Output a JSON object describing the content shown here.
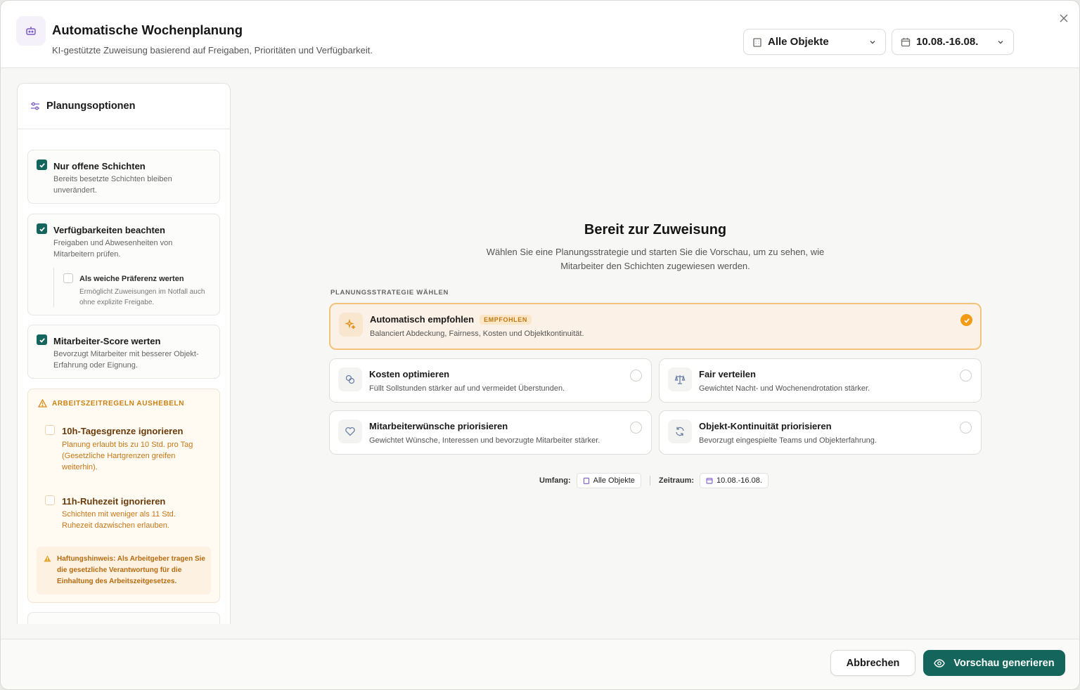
{
  "header": {
    "title": "Automatische Wochenplanung",
    "subtitle": "KI-gestützte Zuweisung basierend auf Freigaben, Prioritäten und Verfügbarkeit.",
    "objects_select": "Alle Objekte",
    "date_select": "10.08.-16.08."
  },
  "sidebar": {
    "title": "Planungsoptionen",
    "options": [
      {
        "title": "Nur offene Schichten",
        "desc_1": "Bereits besetzte Schichten bleiben",
        "desc_2": "unverändert.",
        "checked": true
      },
      {
        "title": "Verfügbarkeiten beachten",
        "desc_1": "Freigaben und Abwesenheiten von",
        "desc_2": "Mitarbeitern prüfen.",
        "checked": true,
        "sub": {
          "title": "Als weiche Präferenz werten",
          "desc_1": "Ermöglicht Zuweisungen im Notfall auch",
          "desc_2": "ohne explizite Freigabe.",
          "checked": false
        }
      },
      {
        "title": "Mitarbeiter-Score werten",
        "desc_1": "Bevorzugt Mitarbeiter mit besserer Objekt-",
        "desc_2": "Erfahrung oder Eignung.",
        "checked": true
      }
    ],
    "work_rules": {
      "header": "ARBEITSZEITREGELN AUSHEBELN",
      "items": [
        {
          "title": "10h-Tagesgrenze ignorieren",
          "desc_1": "Planung erlaubt bis zu 10 Std. pro Tag",
          "desc_2": "(Gesetzliche Hartgrenzen greifen",
          "desc_3": "weiterhin).",
          "checked": false
        },
        {
          "title": "11h-Ruhezeit ignorieren",
          "desc_1": "Schichten mit weniger als 11 Std.",
          "desc_2": "Ruhezeit dazwischen erlauben.",
          "checked": false
        }
      ],
      "liability": "Haftungshinweis: Als Arbeitgeber tragen Sie die gesetzliche Verantwortung für die Einhaltung des Arbeitszeitgesetzes."
    }
  },
  "main": {
    "title": "Bereit zur Zuweisung",
    "subtitle_1": "Wählen Sie eine Planungsstrategie und starten Sie die Vorschau, um zu sehen, wie",
    "subtitle_2": "Mitarbeiter den Schichten zugewiesen werden.",
    "strategy_label": "PLANUNGSSTRATEGIE WÄHLEN",
    "strategies": [
      {
        "title": "Automatisch empfohlen",
        "badge": "EMPFOHLEN",
        "desc": "Balanciert Abdeckung, Fairness, Kosten und Objektkontinuität.",
        "selected": true,
        "icon": "sparkles-icon"
      },
      {
        "title": "Kosten optimieren",
        "desc": "Füllt Sollstunden stärker auf und vermeidet Überstunden.",
        "selected": false,
        "icon": "coins-icon"
      },
      {
        "title": "Fair verteilen",
        "desc": "Gewichtet Nacht- und Wochenendrotation stärker.",
        "selected": false,
        "icon": "scale-icon"
      },
      {
        "title": "Mitarbeiterwünsche priorisieren",
        "desc": "Gewichtet Wünsche, Interessen und bevorzugte Mitarbeiter stärker.",
        "selected": false,
        "icon": "heart-icon"
      },
      {
        "title": "Objekt-Kontinuität priorisieren",
        "desc": "Bevorzugt eingespielte Teams und Objekterfahrung.",
        "selected": false,
        "icon": "refresh-icon"
      }
    ],
    "scope": {
      "label": "Umfang:",
      "value": "Alle Objekte",
      "period_label": "Zeitraum:",
      "period_value": "10.08.-16.08."
    }
  },
  "footer": {
    "cancel": "Abbrechen",
    "primary": "Vorschau generieren"
  },
  "colors": {
    "accent": "#14655c",
    "highlight": "#f29b14",
    "warning": "#c98112"
  }
}
